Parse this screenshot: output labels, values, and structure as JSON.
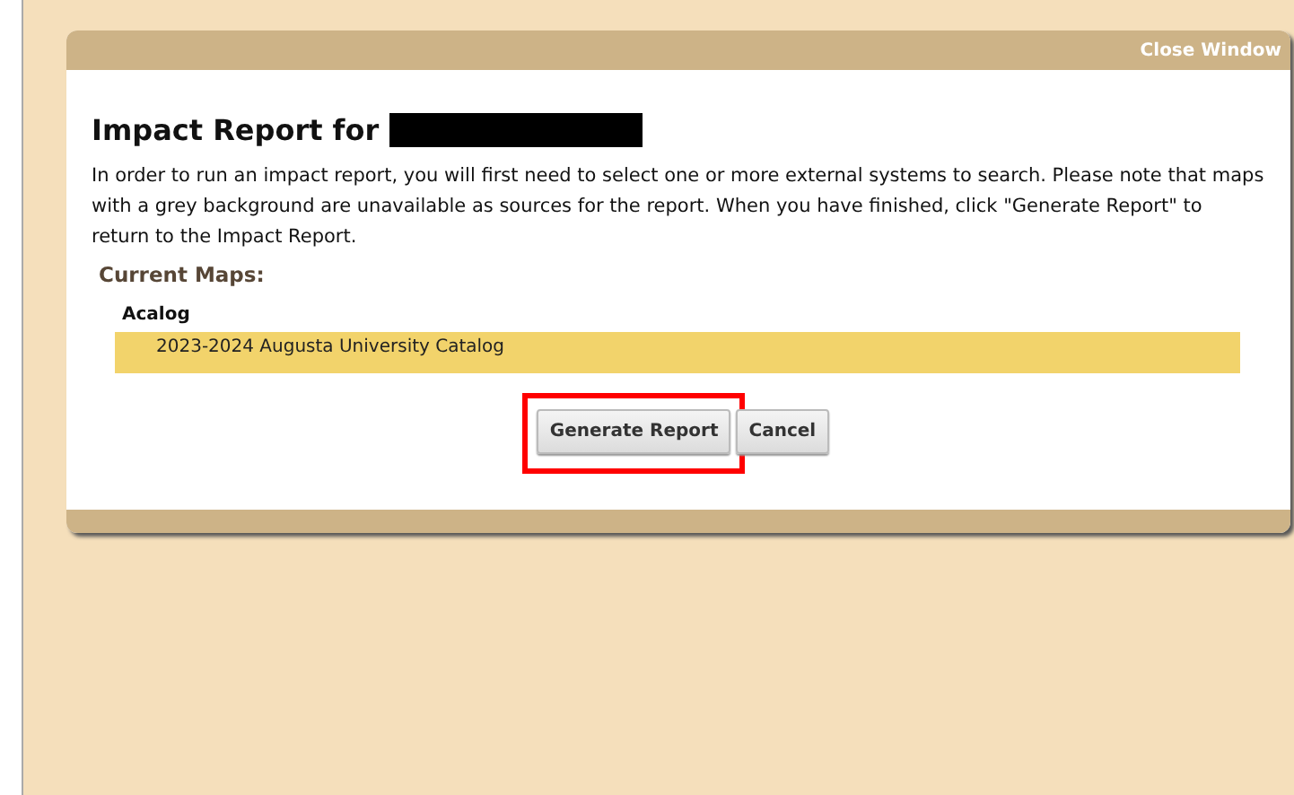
{
  "dialog": {
    "close_label": "Close Window",
    "title": "Impact Report for",
    "title_redacted": true,
    "description": "In order to run an impact report, you will first need to select one or more external systems to search. Please note that maps with a grey background are unavailable as sources for the report. When you have finished, click \"Generate Report\" to return to the Impact Report.",
    "section_label": "Current Maps:",
    "groups": [
      {
        "name": "Acalog",
        "items": [
          {
            "label": "2023-2024 Augusta University Catalog",
            "selected": true
          }
        ]
      }
    ],
    "buttons": [
      {
        "label": "Generate Report",
        "highlighted": true
      },
      {
        "label": "Cancel",
        "highlighted": false
      }
    ]
  }
}
